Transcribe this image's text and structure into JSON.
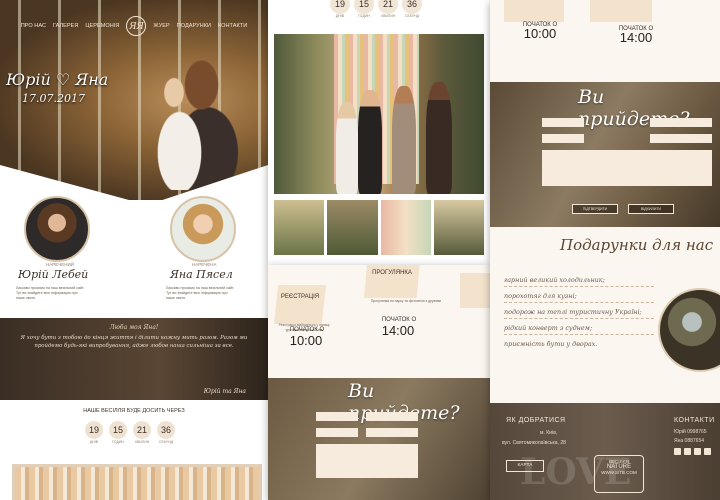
{
  "p1": {
    "nav": [
      "ПРО НАС",
      "ГАЛЕРЕЯ",
      "ЦЕРЕМОНІЯ",
      "ЯЯ",
      "ЖУЕР",
      "ПОДАРУНКИ",
      "КОНТАКТИ"
    ],
    "hero_names": "Юрій ♡ Яна",
    "hero_date": "17.07.2017",
    "groom_role": "НАРЕЧЕНИЙ",
    "groom_name": "Юрій Лебей",
    "bride_role": "НАРЕЧЕНА",
    "bride_name": "Яна Пясел",
    "quote_head": "Люба моя Яна!",
    "quote_text": "Я хочу бути з тобою до кінця життя і ділити кожну мить разом. Разом ми пройдемо будь-які випробування, адже любов наша сильніша за все.",
    "quote_sign": "Юрій та Яна",
    "countdown_label": "НАШЕ ВЕСІЛЛЯ БУДЕ ДОСИТЬ ЧЕРЕЗ",
    "countdown": [
      {
        "num": "19",
        "unit": "днів"
      },
      {
        "num": "15",
        "unit": "годин"
      },
      {
        "num": "21",
        "unit": "хвилин"
      },
      {
        "num": "36",
        "unit": "секунд"
      }
    ]
  },
  "p2": {
    "countdown": [
      {
        "num": "19",
        "unit": "днів"
      },
      {
        "num": "15",
        "unit": "годин"
      },
      {
        "num": "21",
        "unit": "хвилин"
      },
      {
        "num": "36",
        "unit": "секунд"
      }
    ]
  },
  "p3": {
    "registration": "РЕЄСТРАЦІЯ",
    "walk": "ПРОГУЛЯНКА",
    "start_label": "ПОЧАТОК О",
    "time1": "10:00",
    "time2": "14:00",
    "rsvp_title": "Ви прийдете?"
  },
  "p4": {
    "start_label": "ПОЧАТОК О",
    "time1": "10:00",
    "time2": "14:00",
    "rsvp_title": "Ви прийдете?",
    "btn_confirm": "ПІДТВЕРДИТИ",
    "btn_decline": "ВІДХИЛИТИ",
    "gifts_title": "Подарунки для нас",
    "wishes": [
      "гарний великий холодильник;",
      "порохотяг для кузні;",
      "подорож на теплі туристичну Україні;",
      "рідкий конверт з суднем;",
      "приємність бути у дворах."
    ],
    "how_to_get": "ЯК ДОБРАТИСЯ",
    "city": "м. Київ,",
    "street": "вул. Святомиколаївська, 28",
    "map_btn": "КАРТА",
    "contacts": "КОНТАКТИ",
    "phone1": "Юрій 0998765",
    "phone2": "Яна 0887654",
    "badge_l1": "ВЕСІЛЛЯ",
    "badge_l2": "NATURE",
    "badge_l3": "www.site.com"
  }
}
